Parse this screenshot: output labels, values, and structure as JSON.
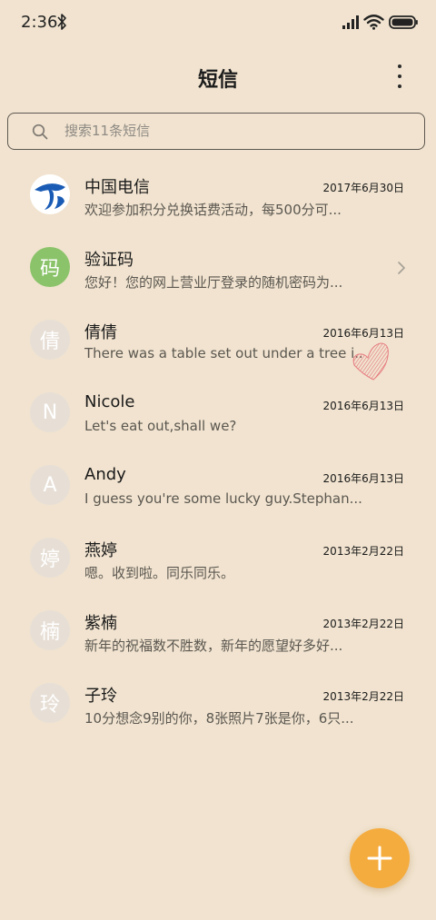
{
  "status_bar": {
    "time": "2:36",
    "icons": [
      "bluetooth-icon",
      "signal-icon",
      "wifi-icon",
      "battery-icon"
    ]
  },
  "header": {
    "title": "短信",
    "more_icon": "more-vertical-icon"
  },
  "search": {
    "placeholder": "搜索11条短信",
    "icon": "search-icon"
  },
  "conversations": [
    {
      "sender": "中国电信",
      "date": "2017年6月30日",
      "preview": "欢迎参加积分兑换话费活动，每500分可...",
      "avatar": "",
      "avatar_type": "logo"
    },
    {
      "sender": "验证码",
      "date": "",
      "preview": "您好！您的网上营业厅登录的随机密码为...",
      "avatar": "码",
      "avatar_type": "green"
    },
    {
      "sender": "倩倩",
      "date": "2016年6月13日",
      "preview": "There was a table set out under a tree i...",
      "avatar": "倩",
      "avatar_type": "default"
    },
    {
      "sender": "Nicole",
      "date": "2016年6月13日",
      "preview": "Let's eat out,shall we?",
      "avatar": "N",
      "avatar_type": "default"
    },
    {
      "sender": "Andy",
      "date": "2016年6月13日",
      "preview": "I guess you're some lucky guy.Stephan...",
      "avatar": "A",
      "avatar_type": "default"
    },
    {
      "sender": "燕婷",
      "date": "2013年2月22日",
      "preview": "嗯。收到啦。同乐同乐。",
      "avatar": "婷",
      "avatar_type": "default"
    },
    {
      "sender": "紫楠",
      "date": "2013年2月22日",
      "preview": "新年的祝福数不胜数，新年的愿望好多好...",
      "avatar": "楠",
      "avatar_type": "default"
    },
    {
      "sender": "子玲",
      "date": "2013年2月22日",
      "preview": "10分想念9别的你，8张照片7张是你，6只...",
      "avatar": "玲",
      "avatar_type": "default"
    }
  ],
  "fab": {
    "icon": "plus-icon"
  },
  "colors": {
    "background": "#f1e3cf",
    "accent": "#f5ac3e",
    "avatar_default": "#e7dfd6",
    "avatar_green": "#8bc36a",
    "telecom_blue": "#1a5bb5"
  }
}
